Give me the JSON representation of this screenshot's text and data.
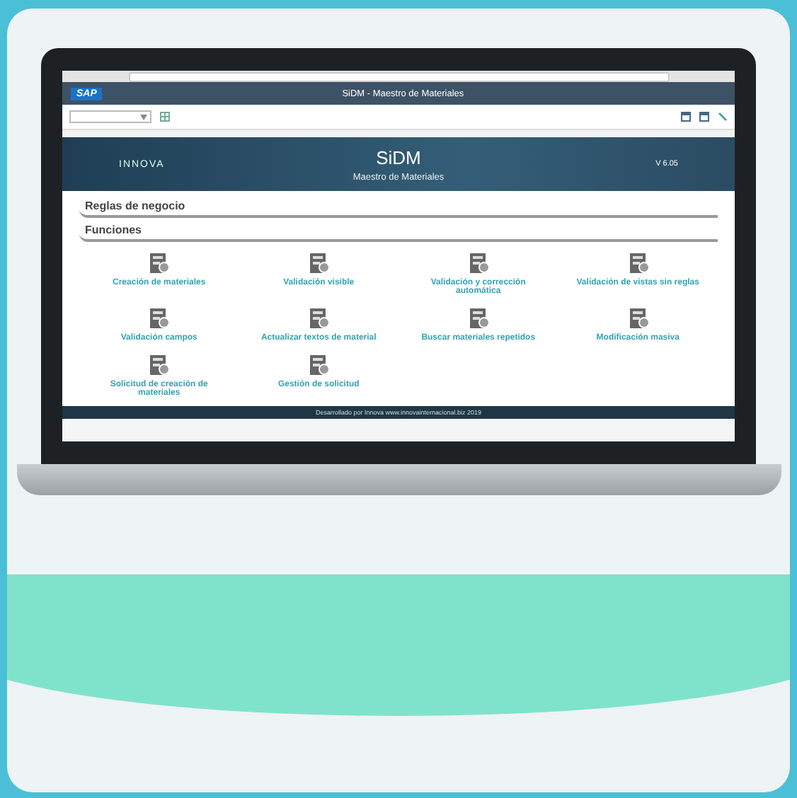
{
  "app_header": {
    "logo": "SAP",
    "title": "SiDM - Maestro de Materiales"
  },
  "banner": {
    "logo": "INNOVA",
    "title": "SiDM",
    "subtitle": "Maestro de Materiales",
    "version": "V 6.05"
  },
  "sections": [
    "Reglas de negocio",
    "Funciones"
  ],
  "functions": [
    {
      "label": "Creación de materiales"
    },
    {
      "label": "Validación visible"
    },
    {
      "label": "Validación y corrección automática"
    },
    {
      "label": "Validación de vistas sin reglas"
    },
    {
      "label": "Validación campos"
    },
    {
      "label": "Actualizar textos de material"
    },
    {
      "label": "Buscar materiales repetidos"
    },
    {
      "label": "Modificación masiva"
    },
    {
      "label": "Solicitud de creación de materiales"
    },
    {
      "label": "Gestión de solicitud"
    }
  ],
  "footer": "Desarrollado por Innova www.innovainternacional.biz 2019"
}
